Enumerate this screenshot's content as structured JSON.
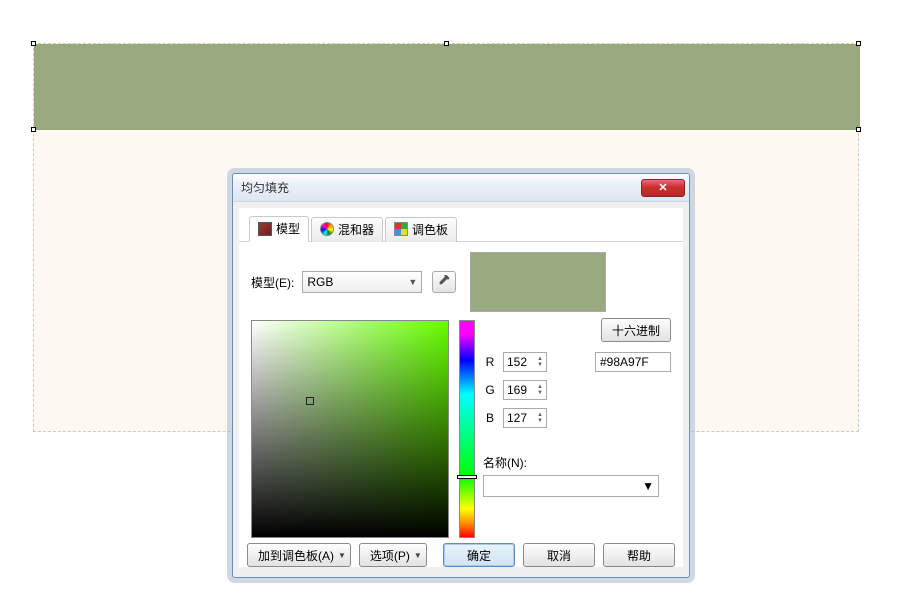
{
  "canvas": {
    "fill": "#98a97f"
  },
  "dialog": {
    "title": "均匀填充",
    "tabs": {
      "model": "模型",
      "mixer": "混和器",
      "palette": "调色板"
    },
    "model_label": "模型(E):",
    "model_value": "RGB",
    "hex_button": "十六进制",
    "channels": {
      "r_label": "R",
      "r_value": "152",
      "g_label": "G",
      "g_value": "169",
      "b_label": "B",
      "b_value": "127"
    },
    "hex_value": "#98A97F",
    "name_label": "名称(N):",
    "name_value": "",
    "color_preview": "#98a97f"
  },
  "buttons": {
    "add_palette": "加到调色板(A)",
    "options": "选项(P)",
    "ok": "确定",
    "cancel": "取消",
    "help": "帮助"
  }
}
